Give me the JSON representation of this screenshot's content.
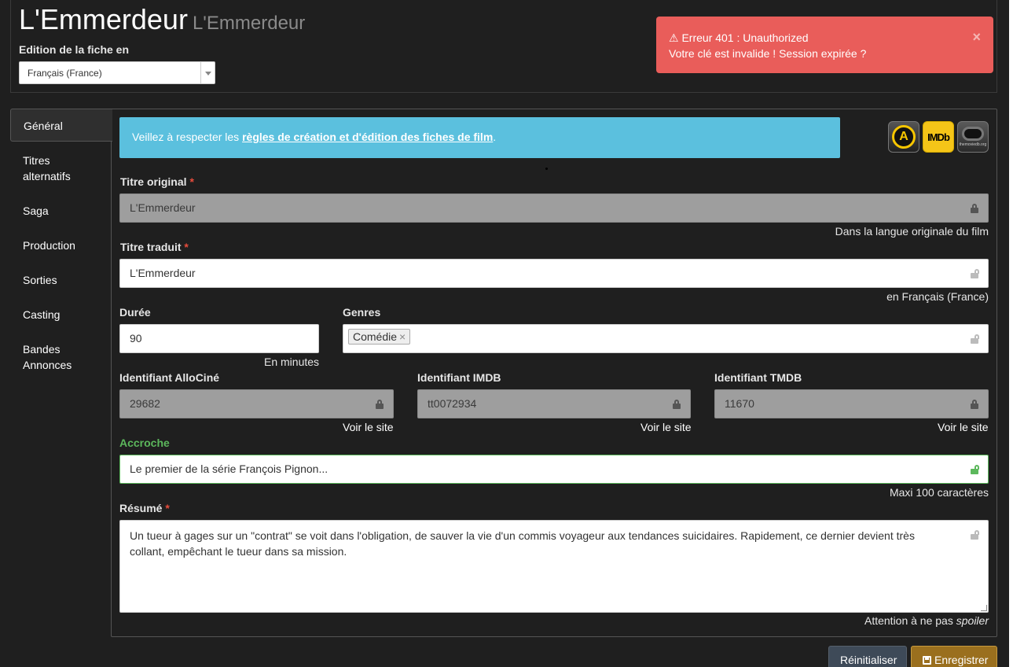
{
  "header": {
    "title": "L'Emmerdeur",
    "subtitle": "L'Emmerdeur",
    "edition_label": "Edition de la fiche en",
    "language_value": "Français (France)"
  },
  "alert": {
    "title": "Erreur 401 : Unauthorized",
    "message": "Votre clé est invalide ! Session expirée ?",
    "close": "×",
    "color": "#e95d5a"
  },
  "sidebar": {
    "items": [
      {
        "label": "Général",
        "active": true
      },
      {
        "label": "Titres alternatifs"
      },
      {
        "label": "Saga"
      },
      {
        "label": "Production"
      },
      {
        "label": "Sorties"
      },
      {
        "label": "Casting"
      },
      {
        "label": "Bandes Annonces"
      }
    ]
  },
  "info": {
    "prefix": "Veillez à respecter les ",
    "link": "règles de création et d'édition des fiches de film",
    "suffix": ".",
    "color": "#5bc0de"
  },
  "external_icons": [
    "allocine-icon",
    "imdb-icon",
    "tmdb-icon"
  ],
  "imdb_logo_text": "IMDb",
  "tmdb_logo_text": "themoviedb.org",
  "form": {
    "titre_original": {
      "label": "Titre original",
      "required": "*",
      "value": "L'Emmerdeur",
      "help": "Dans la langue originale du film"
    },
    "titre_traduit": {
      "label": "Titre traduit",
      "required": "*",
      "value": "L'Emmerdeur",
      "help": "en Français (France)"
    },
    "duree": {
      "label": "Durée",
      "value": "90",
      "help": "En minutes"
    },
    "genres": {
      "label": "Genres",
      "tags": [
        "Comédie"
      ],
      "remove": "×"
    },
    "allocine": {
      "label": "Identifiant AlloCiné",
      "value": "29682",
      "link": "Voir le site"
    },
    "imdb": {
      "label": "Identifiant IMDB",
      "value": "tt0072934",
      "link": "Voir le site"
    },
    "tmdb": {
      "label": "Identifiant TMDB",
      "value": "11670",
      "link": "Voir le site"
    },
    "accroche": {
      "label": "Accroche",
      "value": "Le premier de la série François Pignon...",
      "help": "Maxi 100 caractères"
    },
    "resume": {
      "label": "Résumé",
      "required": "*",
      "value": "Un tueur à gages sur un \"contrat\" se voit dans l'obligation, de sauver la vie d'un commis voyageur aux tendances suicidaires. Rapidement, ce dernier devient très collant, empêchant le tueur dans sa mission.",
      "help_prefix": "Attention à ne pas ",
      "help_em": "spoiler"
    }
  },
  "buttons": {
    "reset": "Réinitialiser",
    "save": "Enregistrer"
  }
}
